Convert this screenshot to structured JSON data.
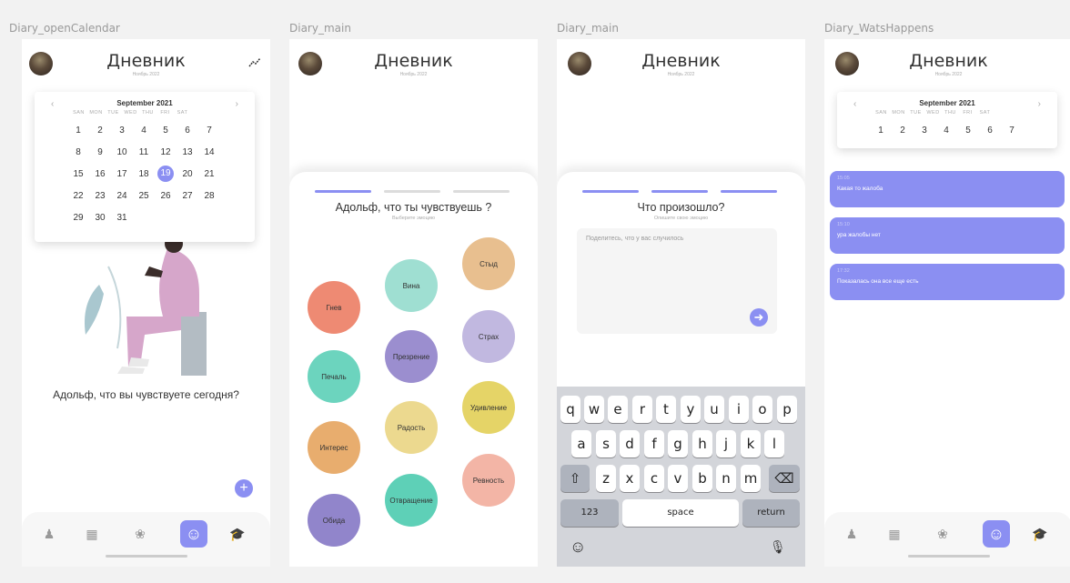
{
  "frames": [
    {
      "label": "Diary_openCalendar"
    },
    {
      "label": "Diary_main"
    },
    {
      "label": "Diary_main"
    },
    {
      "label": "Diary_WatsHappens"
    }
  ],
  "header": {
    "title": "Дневник",
    "subtitle": "Ноябрь 2022"
  },
  "calendar": {
    "month": "September 2021",
    "prev": "‹",
    "next": "›",
    "weekdays": [
      "SAN",
      "MON",
      "TUE",
      "WED",
      "THU",
      "FRI",
      "SAT"
    ],
    "weeks": [
      [
        "1",
        "2",
        "3",
        "4",
        "5",
        "6",
        "7"
      ],
      [
        "8",
        "9",
        "10",
        "11",
        "12",
        "13",
        "14"
      ],
      [
        "15",
        "16",
        "17",
        "18",
        "19",
        "20",
        "21"
      ],
      [
        "22",
        "23",
        "24",
        "25",
        "26",
        "27",
        "28"
      ],
      [
        "29",
        "30",
        "31"
      ]
    ],
    "selected": "19"
  },
  "screen1": {
    "prompt": "Адольф, что вы чувствуете сегодня?",
    "fab": "+"
  },
  "screen2": {
    "question": "Адольф, что ты чувствуешь ?",
    "hint": "Выберите эмоцию",
    "progress_step": 1,
    "emotions": [
      {
        "label": "Гнев",
        "color": "#ee8a73"
      },
      {
        "label": "Вина",
        "color": "#9fdfd2"
      },
      {
        "label": "Стыд",
        "color": "#e8bf8f"
      },
      {
        "label": "Печаль",
        "color": "#6cd4be"
      },
      {
        "label": "Презрение",
        "color": "#9b8ecf"
      },
      {
        "label": "Страх",
        "color": "#c1b8e0"
      },
      {
        "label": "Интерес",
        "color": "#e8ad6e"
      },
      {
        "label": "Радость",
        "color": "#ecd98f"
      },
      {
        "label": "Удивление",
        "color": "#e5d467"
      },
      {
        "label": "Обида",
        "color": "#9185cb"
      },
      {
        "label": "Отвращение",
        "color": "#5ed0b7"
      },
      {
        "label": "Ревность",
        "color": "#f3b5a6"
      }
    ]
  },
  "screen3": {
    "question": "Что произошло?",
    "hint": "Опишите свою эмоцию",
    "placeholder": "Поделитесь, что у вас случилось",
    "send": "➜",
    "keyboard": {
      "row1": [
        "q",
        "w",
        "e",
        "r",
        "t",
        "y",
        "u",
        "i",
        "o",
        "p"
      ],
      "row2": [
        "a",
        "s",
        "d",
        "f",
        "g",
        "h",
        "j",
        "k",
        "l"
      ],
      "row3": [
        "z",
        "x",
        "c",
        "v",
        "b",
        "n",
        "m"
      ],
      "shift": "⇧",
      "backspace": "⌫",
      "numbers": "123",
      "space": "space",
      "return": "return",
      "emoji": "☺",
      "mic": "🎙"
    }
  },
  "screen4": {
    "entries": [
      {
        "time": "15:05",
        "text": "Какая то жалоба"
      },
      {
        "time": "15:10",
        "text": "ура жалобы нет"
      },
      {
        "time": "17:32",
        "text": "Показалась она все еще есть"
      }
    ]
  },
  "tabs": [
    {
      "icon": "meditation-icon",
      "glyph": "♟"
    },
    {
      "icon": "grid-icon",
      "glyph": "▦"
    },
    {
      "icon": "lotus-icon",
      "glyph": "❀"
    },
    {
      "icon": "smiley-icon",
      "glyph": "☺"
    },
    {
      "icon": "graduation-cap-icon",
      "glyph": "🎓"
    }
  ],
  "colors": {
    "accent": "#8b8ff2",
    "progress_inactive": "#dcdcdc"
  }
}
